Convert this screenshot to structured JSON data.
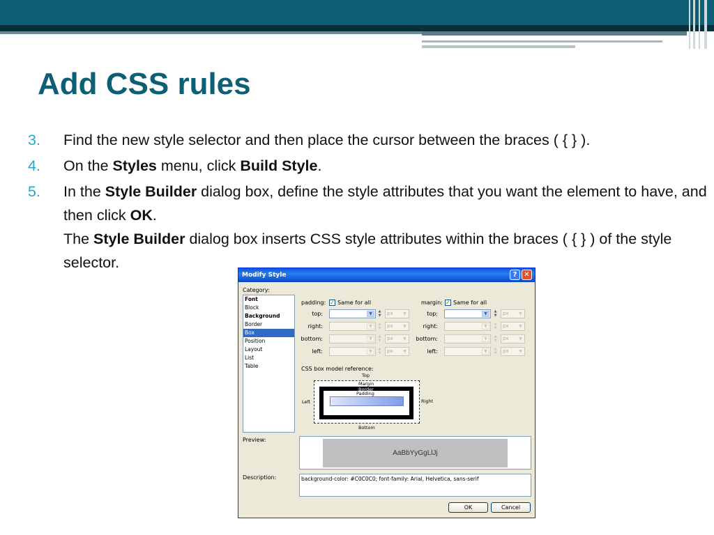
{
  "slide": {
    "title": "Add CSS rules",
    "steps": [
      {
        "num": "3.",
        "parts": [
          {
            "t": "Find the new style selector and then place the cursor between the braces ( { } ).",
            "b": false
          }
        ]
      },
      {
        "num": "4.",
        "parts": [
          {
            "t": "On the ",
            "b": false
          },
          {
            "t": "Styles",
            "b": true
          },
          {
            "t": " menu, click ",
            "b": false
          },
          {
            "t": "Build Style",
            "b": true
          },
          {
            "t": ".",
            "b": false
          }
        ]
      },
      {
        "num": "5.",
        "parts": [
          {
            "t": "In the ",
            "b": false
          },
          {
            "t": "Style Builder",
            "b": true
          },
          {
            "t": " dialog box, define the style attributes that you want the element to have, and then click ",
            "b": false
          },
          {
            "t": "OK",
            "b": true
          },
          {
            "t": ".",
            "b": false
          }
        ],
        "extra": [
          {
            "t": "The ",
            "b": false
          },
          {
            "t": "Style Builder",
            "b": true
          },
          {
            "t": " dialog box inserts CSS style attributes within the braces ( { } ) of the style selector.",
            "b": false
          }
        ]
      }
    ],
    "accent_color": "#0d5f74",
    "number_color": "#26a7c9"
  },
  "dialog": {
    "title": "Modify Style",
    "help_label": "?",
    "close_label": "✕",
    "category_label": "Category:",
    "categories": [
      {
        "label": "Font",
        "bold": true,
        "selected": false
      },
      {
        "label": "Block",
        "bold": false,
        "selected": false
      },
      {
        "label": "Background",
        "bold": true,
        "selected": false
      },
      {
        "label": "Border",
        "bold": false,
        "selected": false
      },
      {
        "label": "Box",
        "bold": false,
        "selected": true
      },
      {
        "label": "Position",
        "bold": false,
        "selected": false
      },
      {
        "label": "Layout",
        "bold": false,
        "selected": false
      },
      {
        "label": "List",
        "bold": false,
        "selected": false
      },
      {
        "label": "Table",
        "bold": false,
        "selected": false
      }
    ],
    "padding": {
      "label": "padding:",
      "same_for_all": "Same for all",
      "checked": true,
      "rows": [
        {
          "label": "top:",
          "enabled": true
        },
        {
          "label": "right:",
          "enabled": false
        },
        {
          "label": "bottom:",
          "enabled": false
        },
        {
          "label": "left:",
          "enabled": false
        }
      ]
    },
    "margin": {
      "label": "margin:",
      "same_for_all": "Same for all",
      "checked": true,
      "rows": [
        {
          "label": "top:",
          "enabled": true
        },
        {
          "label": "right:",
          "enabled": false
        },
        {
          "label": "bottom:",
          "enabled": false
        },
        {
          "label": "left:",
          "enabled": false
        }
      ]
    },
    "unit": "px",
    "box_model": {
      "label": "CSS box model reference:",
      "top": "Top",
      "bottom": "Bottom",
      "left": "Left",
      "right": "Right",
      "margin": "Margin",
      "border": "Border",
      "padding": "Padding"
    },
    "preview_label": "Preview:",
    "preview_text": "AaBbYyGgLlJj",
    "description_label": "Description:",
    "description_text": "background-color: #C0C0C0; font-family: Arial, Helvetica, sans-serif",
    "ok_label": "OK",
    "cancel_label": "Cancel"
  }
}
